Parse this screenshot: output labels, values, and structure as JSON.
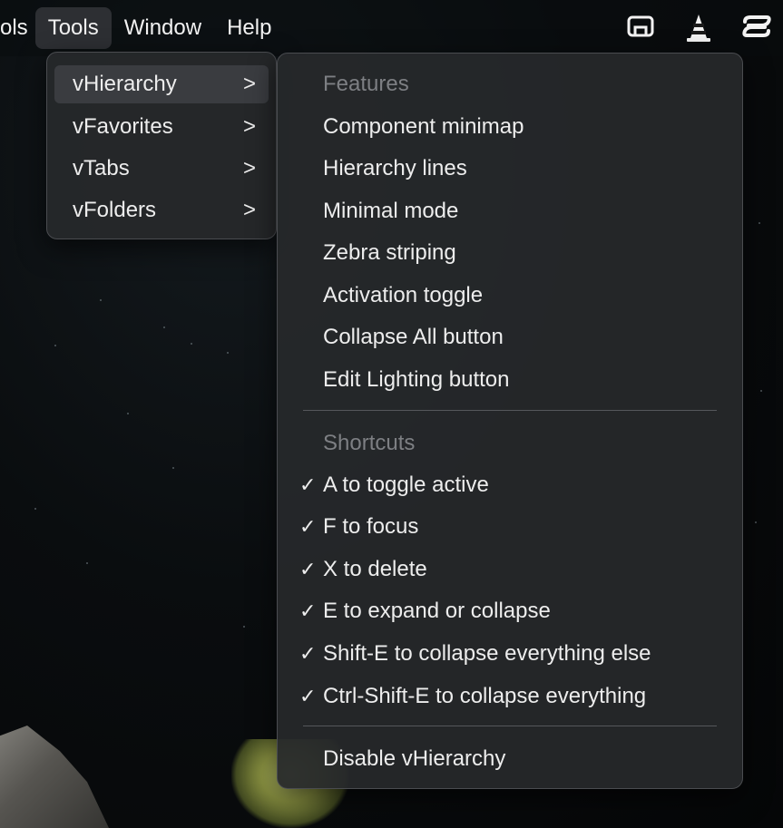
{
  "menubar": {
    "items": [
      "ols",
      "Tools",
      "Window",
      "Help"
    ],
    "status_icons": [
      "display-mirror-icon",
      "vlc-cone-icon",
      "script-editor-icon"
    ]
  },
  "tools_menu": {
    "items": [
      {
        "label": "vHierarchy",
        "chevron": ">"
      },
      {
        "label": "vFavorites",
        "chevron": ">"
      },
      {
        "label": "vTabs",
        "chevron": ">"
      },
      {
        "label": "vFolders",
        "chevron": ">"
      }
    ]
  },
  "vhierarchy_menu": {
    "features_header": "Features",
    "features": [
      "Component minimap",
      "Hierarchy lines",
      "Minimal mode",
      "Zebra striping",
      "Activation toggle",
      "Collapse All button",
      "Edit Lighting button"
    ],
    "shortcuts_header": "Shortcuts",
    "shortcuts": [
      {
        "label": "A to toggle active",
        "checked": true
      },
      {
        "label": "F to focus",
        "checked": true
      },
      {
        "label": "X to delete",
        "checked": true
      },
      {
        "label": "E to expand or collapse",
        "checked": true
      },
      {
        "label": "Shift-E to collapse everything else",
        "checked": true
      },
      {
        "label": "Ctrl-Shift-E to collapse everything",
        "checked": true
      }
    ],
    "check_glyph": "✓",
    "disable_label": "Disable vHierarchy"
  }
}
